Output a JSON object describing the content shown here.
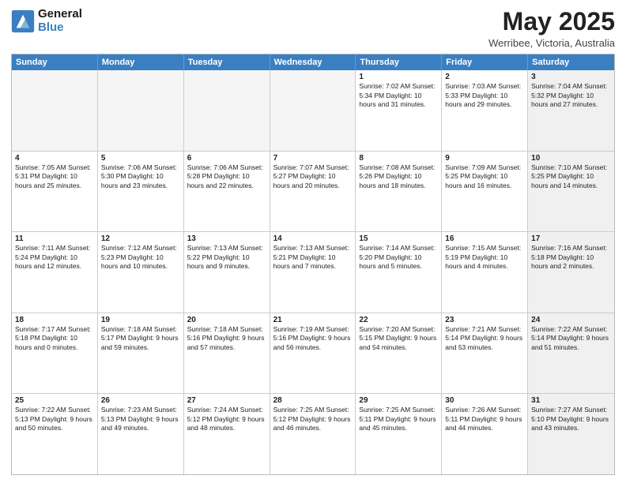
{
  "header": {
    "logo_line1": "General",
    "logo_line2": "Blue",
    "month_year": "May 2025",
    "location": "Werribee, Victoria, Australia"
  },
  "weekdays": [
    "Sunday",
    "Monday",
    "Tuesday",
    "Wednesday",
    "Thursday",
    "Friday",
    "Saturday"
  ],
  "rows": [
    [
      {
        "day": "",
        "text": "",
        "empty": true
      },
      {
        "day": "",
        "text": "",
        "empty": true
      },
      {
        "day": "",
        "text": "",
        "empty": true
      },
      {
        "day": "",
        "text": "",
        "empty": true
      },
      {
        "day": "1",
        "text": "Sunrise: 7:02 AM\nSunset: 5:34 PM\nDaylight: 10 hours\nand 31 minutes."
      },
      {
        "day": "2",
        "text": "Sunrise: 7:03 AM\nSunset: 5:33 PM\nDaylight: 10 hours\nand 29 minutes."
      },
      {
        "day": "3",
        "text": "Sunrise: 7:04 AM\nSunset: 5:32 PM\nDaylight: 10 hours\nand 27 minutes.",
        "shaded": true
      }
    ],
    [
      {
        "day": "4",
        "text": "Sunrise: 7:05 AM\nSunset: 5:31 PM\nDaylight: 10 hours\nand 25 minutes."
      },
      {
        "day": "5",
        "text": "Sunrise: 7:06 AM\nSunset: 5:30 PM\nDaylight: 10 hours\nand 23 minutes."
      },
      {
        "day": "6",
        "text": "Sunrise: 7:06 AM\nSunset: 5:28 PM\nDaylight: 10 hours\nand 22 minutes."
      },
      {
        "day": "7",
        "text": "Sunrise: 7:07 AM\nSunset: 5:27 PM\nDaylight: 10 hours\nand 20 minutes."
      },
      {
        "day": "8",
        "text": "Sunrise: 7:08 AM\nSunset: 5:26 PM\nDaylight: 10 hours\nand 18 minutes."
      },
      {
        "day": "9",
        "text": "Sunrise: 7:09 AM\nSunset: 5:25 PM\nDaylight: 10 hours\nand 16 minutes."
      },
      {
        "day": "10",
        "text": "Sunrise: 7:10 AM\nSunset: 5:25 PM\nDaylight: 10 hours\nand 14 minutes.",
        "shaded": true
      }
    ],
    [
      {
        "day": "11",
        "text": "Sunrise: 7:11 AM\nSunset: 5:24 PM\nDaylight: 10 hours\nand 12 minutes."
      },
      {
        "day": "12",
        "text": "Sunrise: 7:12 AM\nSunset: 5:23 PM\nDaylight: 10 hours\nand 10 minutes."
      },
      {
        "day": "13",
        "text": "Sunrise: 7:13 AM\nSunset: 5:22 PM\nDaylight: 10 hours\nand 9 minutes."
      },
      {
        "day": "14",
        "text": "Sunrise: 7:13 AM\nSunset: 5:21 PM\nDaylight: 10 hours\nand 7 minutes."
      },
      {
        "day": "15",
        "text": "Sunrise: 7:14 AM\nSunset: 5:20 PM\nDaylight: 10 hours\nand 5 minutes."
      },
      {
        "day": "16",
        "text": "Sunrise: 7:15 AM\nSunset: 5:19 PM\nDaylight: 10 hours\nand 4 minutes."
      },
      {
        "day": "17",
        "text": "Sunrise: 7:16 AM\nSunset: 5:18 PM\nDaylight: 10 hours\nand 2 minutes.",
        "shaded": true
      }
    ],
    [
      {
        "day": "18",
        "text": "Sunrise: 7:17 AM\nSunset: 5:18 PM\nDaylight: 10 hours\nand 0 minutes."
      },
      {
        "day": "19",
        "text": "Sunrise: 7:18 AM\nSunset: 5:17 PM\nDaylight: 9 hours\nand 59 minutes."
      },
      {
        "day": "20",
        "text": "Sunrise: 7:18 AM\nSunset: 5:16 PM\nDaylight: 9 hours\nand 57 minutes."
      },
      {
        "day": "21",
        "text": "Sunrise: 7:19 AM\nSunset: 5:16 PM\nDaylight: 9 hours\nand 56 minutes."
      },
      {
        "day": "22",
        "text": "Sunrise: 7:20 AM\nSunset: 5:15 PM\nDaylight: 9 hours\nand 54 minutes."
      },
      {
        "day": "23",
        "text": "Sunrise: 7:21 AM\nSunset: 5:14 PM\nDaylight: 9 hours\nand 53 minutes."
      },
      {
        "day": "24",
        "text": "Sunrise: 7:22 AM\nSunset: 5:14 PM\nDaylight: 9 hours\nand 51 minutes.",
        "shaded": true
      }
    ],
    [
      {
        "day": "25",
        "text": "Sunrise: 7:22 AM\nSunset: 5:13 PM\nDaylight: 9 hours\nand 50 minutes."
      },
      {
        "day": "26",
        "text": "Sunrise: 7:23 AM\nSunset: 5:13 PM\nDaylight: 9 hours\nand 49 minutes."
      },
      {
        "day": "27",
        "text": "Sunrise: 7:24 AM\nSunset: 5:12 PM\nDaylight: 9 hours\nand 48 minutes."
      },
      {
        "day": "28",
        "text": "Sunrise: 7:25 AM\nSunset: 5:12 PM\nDaylight: 9 hours\nand 46 minutes."
      },
      {
        "day": "29",
        "text": "Sunrise: 7:25 AM\nSunset: 5:11 PM\nDaylight: 9 hours\nand 45 minutes."
      },
      {
        "day": "30",
        "text": "Sunrise: 7:26 AM\nSunset: 5:11 PM\nDaylight: 9 hours\nand 44 minutes."
      },
      {
        "day": "31",
        "text": "Sunrise: 7:27 AM\nSunset: 5:10 PM\nDaylight: 9 hours\nand 43 minutes.",
        "shaded": true
      }
    ]
  ]
}
